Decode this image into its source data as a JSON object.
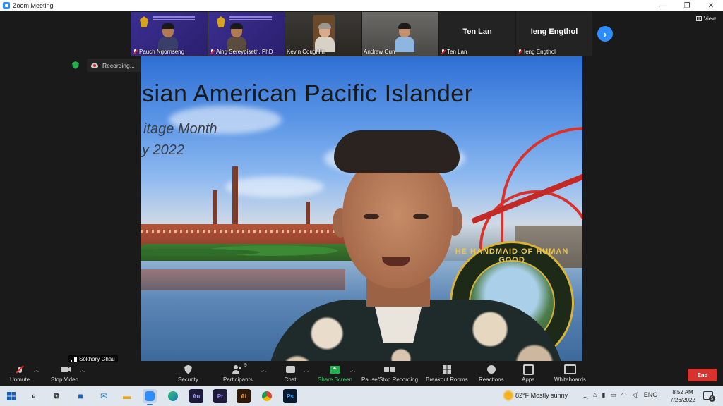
{
  "window": {
    "title": "Zoom Meeting",
    "controls": [
      "—",
      "❐",
      "✕"
    ]
  },
  "thumbnails": [
    {
      "name": "Pauch Ngornseng",
      "muted": true,
      "style": "blue"
    },
    {
      "name": "Aing Sereypiseth, PhD",
      "muted": true,
      "style": "blue"
    },
    {
      "name": "Kevin Coughlin",
      "muted": false,
      "style": "room"
    },
    {
      "name": "Andrew Oun",
      "muted": false,
      "style": "room2"
    },
    {
      "name": "Ten Lan",
      "muted": true,
      "style": "dark",
      "big_label": "Ten Lan"
    },
    {
      "name": "Ieng Engthol",
      "muted": true,
      "style": "dark",
      "big_label": "Ieng Engthol"
    }
  ],
  "view_label": "View",
  "next_label": "›",
  "recording": {
    "label": "Recording...",
    "pause_icon": "pause-icon",
    "stop_icon": "stop-icon"
  },
  "video": {
    "speaker_name": "Sokhary Chau",
    "slide_title": "sian American Pacific Islander",
    "slide_line2": "itage Month",
    "slide_line3": "y 2022",
    "seal_text": "HE HANDMAID OF HUMAN GOOD"
  },
  "toolbar": {
    "unmute": "Unmute",
    "stop_video": "Stop Video",
    "security": "Security",
    "participants": "Participants",
    "participants_count": "9",
    "chat": "Chat",
    "share_screen": "Share Screen",
    "pause_stop_recording": "Pause/Stop Recording",
    "breakout_rooms": "Breakout Rooms",
    "reactions": "Reactions",
    "apps": "Apps",
    "whiteboards": "Whiteboards",
    "end": "End",
    "share_color": "#23b14d",
    "end_color": "#d9312b"
  },
  "taskbar": {
    "apps": [
      {
        "icon": "windows-start-icon",
        "label": ""
      },
      {
        "icon": "search-icon",
        "label": ""
      },
      {
        "icon": "task-view-icon",
        "label": ""
      },
      {
        "icon": "store-icon",
        "label": ""
      },
      {
        "icon": "mail-icon",
        "label": ""
      },
      {
        "icon": "file-explorer-icon",
        "label": ""
      },
      {
        "icon": "zoom-icon",
        "label": ""
      },
      {
        "icon": "edge-icon",
        "label": ""
      },
      {
        "icon": "audition-icon",
        "label": "Au"
      },
      {
        "icon": "premiere-icon",
        "label": "Pr"
      },
      {
        "icon": "illustrator-icon",
        "label": "Ai"
      },
      {
        "icon": "chrome-icon",
        "label": ""
      },
      {
        "icon": "photoshop-icon",
        "label": "Ps"
      }
    ],
    "weather": "82°F  Mostly sunny",
    "language": "ENG",
    "time": "8:52 AM",
    "date": "7/26/2022",
    "notifications": "5"
  }
}
